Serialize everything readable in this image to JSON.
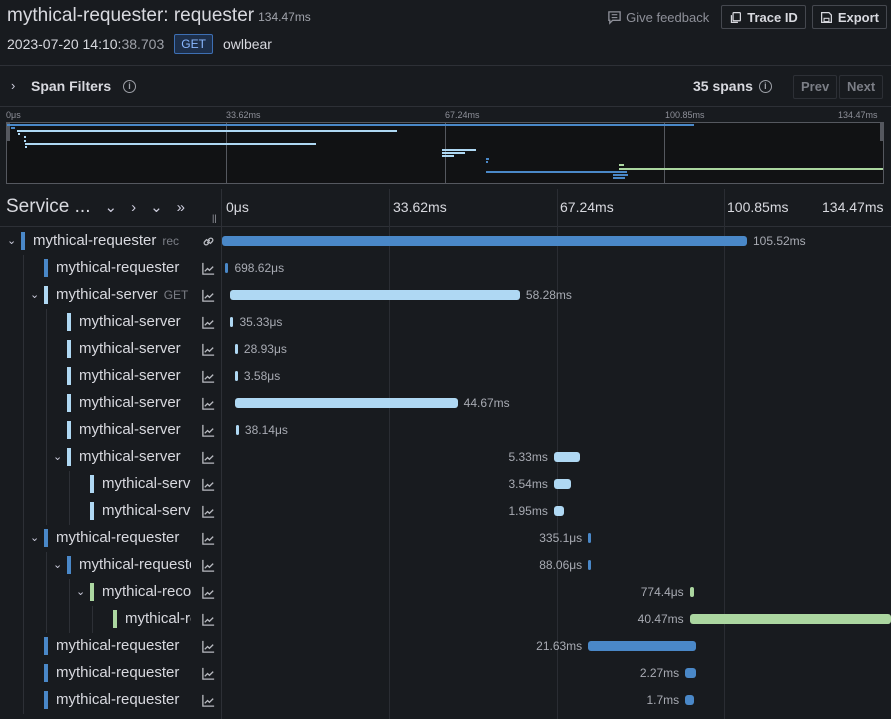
{
  "header": {
    "title": "mythical-requester: requester",
    "duration": "134.47ms",
    "date": "2023-07-20 14:10:",
    "time_ms": "38.703",
    "method": "GET",
    "url": "owlbear",
    "feedback_label": "Give feedback",
    "trace_id_label": "Trace ID",
    "export_label": "Export"
  },
  "filters": {
    "label": "Span Filters",
    "span_count": "35 spans",
    "prev_label": "Prev",
    "next_label": "Next"
  },
  "minimap": {
    "ticks": [
      "0μs",
      "33.62ms",
      "67.24ms",
      "100.85ms",
      "134.47ms"
    ]
  },
  "timeline": {
    "service_header": "Service ...",
    "ticks": [
      "0μs",
      "33.62ms",
      "67.24ms",
      "100.85ms",
      "134.47ms"
    ],
    "total_ms": 134.47
  },
  "colors": {
    "requester": "#4a88c8",
    "server": "#afd8f3",
    "green": "#abd6a0"
  },
  "spans": [
    {
      "name": "mythical-requester",
      "op": "rec",
      "depth": 0,
      "toggle": "expanded",
      "service": "requester",
      "icon": "link",
      "start_ms": 0,
      "dur_ms": 105.52,
      "label": "105.52ms",
      "label_side": "right"
    },
    {
      "name": "mythical-requester",
      "op": "",
      "depth": 1,
      "toggle": "",
      "service": "requester",
      "icon": "chart",
      "start_ms": 0.6,
      "dur_ms": 0.7,
      "label": "698.62μs",
      "label_side": "right"
    },
    {
      "name": "mythical-server",
      "op": "GET",
      "depth": 1,
      "toggle": "expanded",
      "service": "server",
      "icon": "chart",
      "start_ms": 1.6,
      "dur_ms": 58.28,
      "label": "58.28ms",
      "label_side": "right"
    },
    {
      "name": "mythical-server",
      "op": "",
      "depth": 2,
      "toggle": "",
      "service": "server",
      "icon": "chart",
      "start_ms": 1.7,
      "dur_ms": 0.035,
      "label": "35.33μs",
      "label_side": "right"
    },
    {
      "name": "mythical-server",
      "op": "",
      "depth": 2,
      "toggle": "",
      "service": "server",
      "icon": "chart",
      "start_ms": 2.6,
      "dur_ms": 0.029,
      "label": "28.93μs",
      "label_side": "right"
    },
    {
      "name": "mythical-server",
      "op": "",
      "depth": 2,
      "toggle": "",
      "service": "server",
      "icon": "chart",
      "start_ms": 2.6,
      "dur_ms": 0.0036,
      "label": "3.58μs",
      "label_side": "right"
    },
    {
      "name": "mythical-server",
      "op": "",
      "depth": 2,
      "toggle": "",
      "service": "server",
      "icon": "chart",
      "start_ms": 2.7,
      "dur_ms": 44.67,
      "label": "44.67ms",
      "label_side": "right"
    },
    {
      "name": "mythical-server",
      "op": "",
      "depth": 2,
      "toggle": "",
      "service": "server",
      "icon": "chart",
      "start_ms": 2.8,
      "dur_ms": 0.038,
      "label": "38.14μs",
      "label_side": "right"
    },
    {
      "name": "mythical-server",
      "op": "",
      "depth": 2,
      "toggle": "expanded",
      "service": "server",
      "icon": "chart",
      "start_ms": 66.7,
      "dur_ms": 5.33,
      "label": "5.33ms",
      "label_side": "left"
    },
    {
      "name": "mythical-server",
      "op": "",
      "depth": 3,
      "toggle": "",
      "service": "server",
      "icon": "chart",
      "start_ms": 66.7,
      "dur_ms": 3.54,
      "label": "3.54ms",
      "label_side": "left"
    },
    {
      "name": "mythical-server",
      "op": "",
      "depth": 3,
      "toggle": "",
      "service": "server",
      "icon": "chart",
      "start_ms": 66.7,
      "dur_ms": 1.95,
      "label": "1.95ms",
      "label_side": "left"
    },
    {
      "name": "mythical-requester",
      "op": "",
      "depth": 1,
      "toggle": "expanded",
      "service": "requester",
      "icon": "chart",
      "start_ms": 73.6,
      "dur_ms": 0.335,
      "label": "335.1μs",
      "label_side": "left"
    },
    {
      "name": "mythical-requester",
      "op": "",
      "depth": 2,
      "toggle": "expanded",
      "service": "requester",
      "icon": "chart",
      "start_ms": 73.6,
      "dur_ms": 0.088,
      "label": "88.06μs",
      "label_side": "left"
    },
    {
      "name": "mythical-recorder",
      "op": "",
      "depth": 3,
      "toggle": "expanded",
      "service": "green",
      "icon": "chart",
      "start_ms": 94.0,
      "dur_ms": 0.774,
      "label": "774.4μs",
      "label_side": "left"
    },
    {
      "name": "mythical-recorder",
      "op": "",
      "depth": 4,
      "toggle": "",
      "service": "green",
      "icon": "chart",
      "start_ms": 94.0,
      "dur_ms": 40.47,
      "label": "40.47ms",
      "label_side": "left"
    },
    {
      "name": "mythical-requester",
      "op": "",
      "depth": 1,
      "toggle": "",
      "service": "requester",
      "icon": "chart",
      "start_ms": 73.6,
      "dur_ms": 21.63,
      "label": "21.63ms",
      "label_side": "left"
    },
    {
      "name": "mythical-requester",
      "op": "",
      "depth": 1,
      "toggle": "",
      "service": "requester",
      "icon": "chart",
      "start_ms": 93.1,
      "dur_ms": 2.27,
      "label": "2.27ms",
      "label_side": "left"
    },
    {
      "name": "mythical-requester",
      "op": "",
      "depth": 1,
      "toggle": "",
      "service": "requester",
      "icon": "chart",
      "start_ms": 93.1,
      "dur_ms": 1.7,
      "label": "1.7ms",
      "label_side": "left"
    }
  ]
}
